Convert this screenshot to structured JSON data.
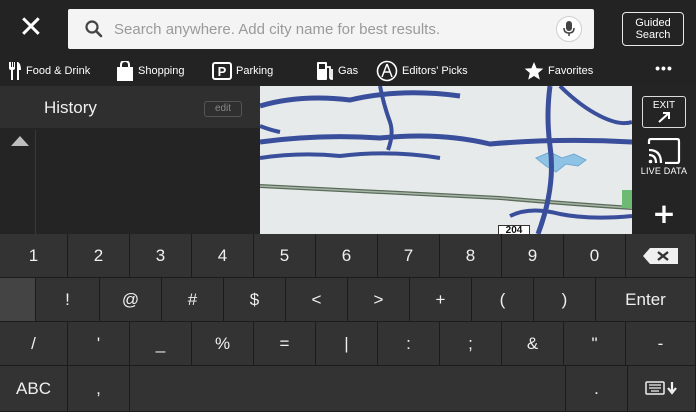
{
  "search": {
    "placeholder": "Search anywhere. Add city name for best results.",
    "guided_line1": "Guided",
    "guided_line2": "Search"
  },
  "categories": [
    {
      "label": "Food & Drink",
      "icon": "fork-knife-icon"
    },
    {
      "label": "Shopping",
      "icon": "shopping-bag-icon"
    },
    {
      "label": "Parking",
      "icon": "parking-icon"
    },
    {
      "label": "Gas",
      "icon": "gas-pump-icon"
    },
    {
      "label": "Editors' Picks",
      "icon": "editors-picks-icon"
    },
    {
      "label": "Favorites",
      "icon": "star-icon"
    }
  ],
  "more_label": "•••",
  "history": {
    "title": "History",
    "edit_label": "edit"
  },
  "map": {
    "route_shield": "204",
    "road_color": "#3a4f9c",
    "water_color": "#8ec3e6",
    "land_color": "#e7eaea"
  },
  "side_buttons": {
    "exit_line1": "EXIT",
    "live_data_label": "LIVE DATA",
    "zoom_in": "+"
  },
  "keyboard": {
    "row1": [
      "1",
      "2",
      "3",
      "4",
      "5",
      "6",
      "7",
      "8",
      "9",
      "0"
    ],
    "row2": [
      "!",
      "@",
      "#",
      "$",
      "<",
      ">",
      "+",
      "(",
      ")"
    ],
    "enter_label": "Enter",
    "row3": [
      "/",
      "'",
      "_",
      "%",
      "=",
      "|",
      ":",
      ";",
      "&",
      "\"",
      "-"
    ],
    "abc_label": "ABC",
    "comma": ",",
    "period": "."
  }
}
